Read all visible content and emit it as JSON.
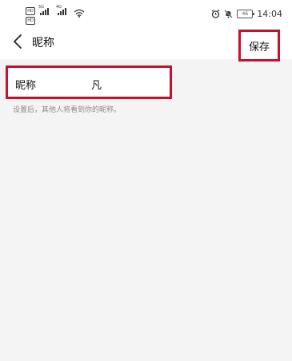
{
  "status_bar": {
    "time": "14:04",
    "battery_level": "46",
    "network_type": "4G",
    "signal_tag": "5G",
    "sim_labels": [
      "HD",
      "HD"
    ]
  },
  "header": {
    "title": "昵称",
    "save_label": "保存"
  },
  "form": {
    "field_label": "昵称",
    "field_value": "凡"
  },
  "hint": "设置后，其他人将看到你的昵称。",
  "colors": {
    "highlight": "#c8102e",
    "background": "#f4f4f4",
    "hint_text": "#8a8a8a"
  }
}
